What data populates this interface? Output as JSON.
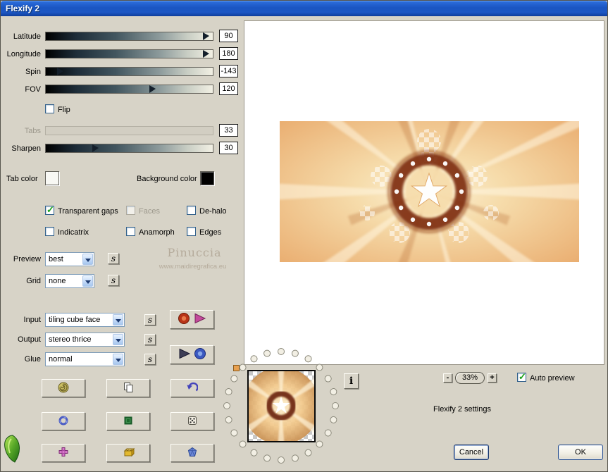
{
  "window": {
    "title": "Flexify 2"
  },
  "sliders": {
    "latitude": {
      "label": "Latitude",
      "value": "90",
      "pos": 96
    },
    "longitude": {
      "label": "Longitude",
      "value": "180",
      "pos": 96
    },
    "spin": {
      "label": "Spin",
      "value": "-143",
      "pos": 9
    },
    "fov": {
      "label": "FOV",
      "value": "120",
      "pos": 64
    },
    "tabs": {
      "label": "Tabs",
      "value": "33"
    },
    "sharpen": {
      "label": "Sharpen",
      "value": "30",
      "pos": 30
    }
  },
  "checkboxes": {
    "flip": {
      "label": "Flip",
      "check": ""
    },
    "transparent_gaps": {
      "label": "Transparent gaps",
      "check": "✓"
    },
    "faces": {
      "label": "Faces",
      "check": ""
    },
    "de_halo": {
      "label": "De-halo",
      "check": ""
    },
    "indicatrix": {
      "label": "Indicatrix",
      "check": ""
    },
    "anamorph": {
      "label": "Anamorph",
      "check": ""
    },
    "edges": {
      "label": "Edges",
      "check": ""
    },
    "auto_preview": {
      "label": "Auto preview",
      "check": "✓"
    }
  },
  "swatches": {
    "tab_color_label": "Tab color",
    "tab_color": "#f8f8f4",
    "background_color_label": "Background color",
    "background_color": "#000000"
  },
  "combos": {
    "preview": {
      "label": "Preview",
      "value": "best"
    },
    "grid": {
      "label": "Grid",
      "value": "none"
    },
    "input": {
      "label": "Input",
      "value": "tiling cube face"
    },
    "output": {
      "label": "Output",
      "value": "stereo thrice"
    },
    "glue": {
      "label": "Glue",
      "value": "normal"
    }
  },
  "s_button": "s",
  "watermark": {
    "line1": "Pinuccia",
    "line2": "www.maidiregrafica.eu"
  },
  "zoom": {
    "minus": "-",
    "level": "33%",
    "plus": "+"
  },
  "status_text": "Flexify 2 settings",
  "info_button": "i",
  "actions": {
    "cancel": "Cancel",
    "ok": "OK"
  }
}
